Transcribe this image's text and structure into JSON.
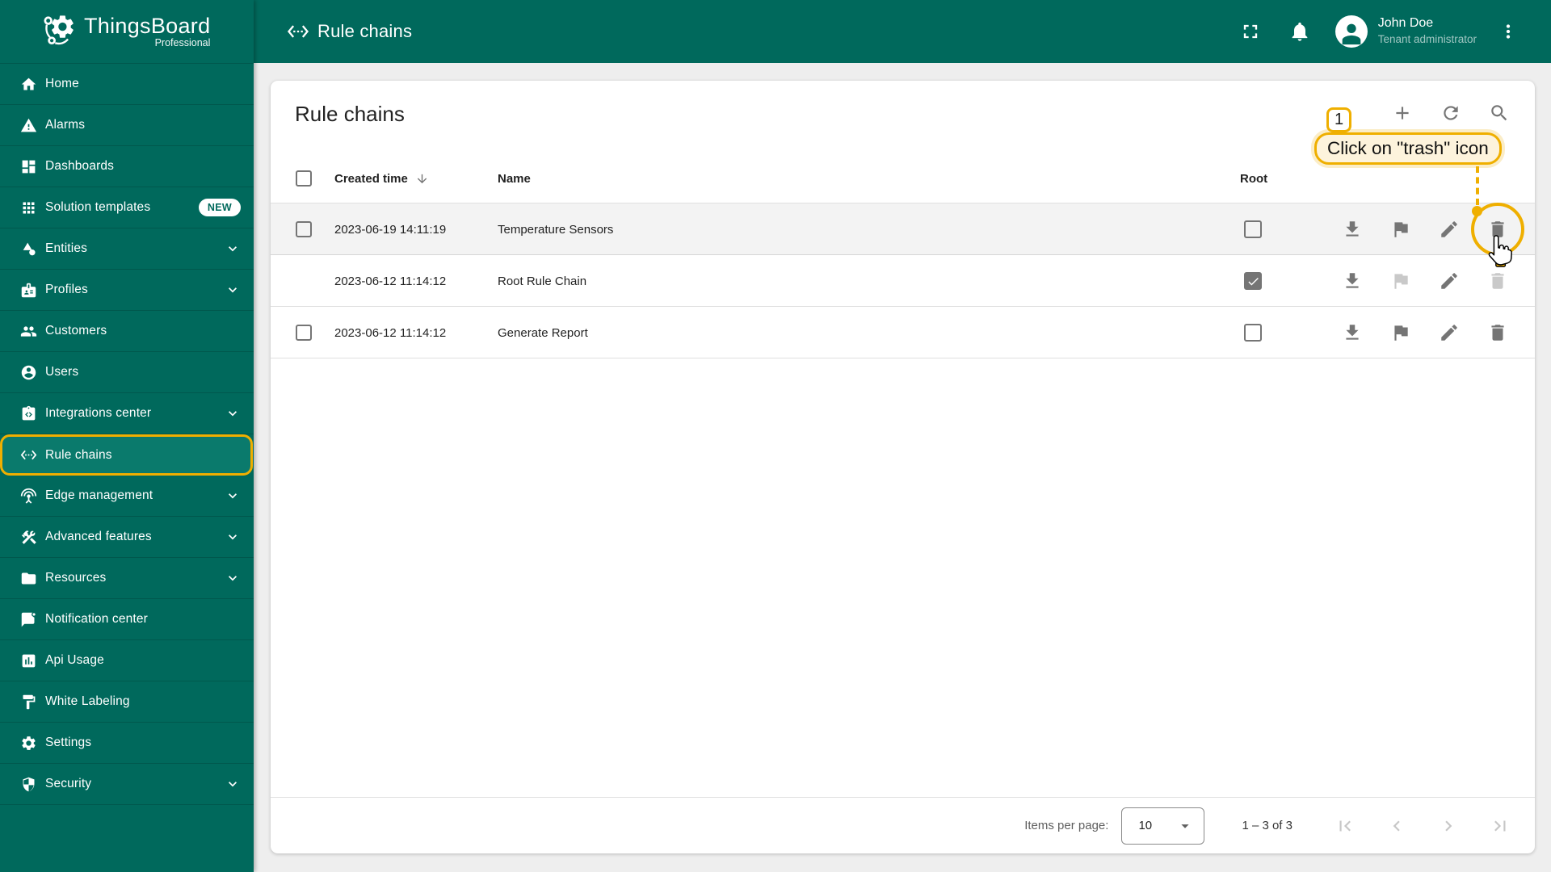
{
  "app": {
    "name": "ThingsBoard",
    "edition": "Professional"
  },
  "topbar": {
    "title": "Rule chains",
    "user_name": "John Doe",
    "user_role": "Tenant administrator"
  },
  "sidebar": {
    "items": [
      {
        "label": "Home"
      },
      {
        "label": "Alarms"
      },
      {
        "label": "Dashboards"
      },
      {
        "label": "Solution templates",
        "badge": "NEW"
      },
      {
        "label": "Entities",
        "expandable": true
      },
      {
        "label": "Profiles",
        "expandable": true
      },
      {
        "label": "Customers"
      },
      {
        "label": "Users"
      },
      {
        "label": "Integrations center",
        "expandable": true
      },
      {
        "label": "Rule chains",
        "selected": true
      },
      {
        "label": "Edge management",
        "expandable": true
      },
      {
        "label": "Advanced features",
        "expandable": true
      },
      {
        "label": "Resources",
        "expandable": true
      },
      {
        "label": "Notification center"
      },
      {
        "label": "Api Usage"
      },
      {
        "label": "White Labeling"
      },
      {
        "label": "Settings"
      },
      {
        "label": "Security",
        "expandable": true
      }
    ]
  },
  "page": {
    "title": "Rule chains",
    "columns": {
      "created_time": "Created time",
      "name": "Name",
      "root": "Root"
    },
    "rows": [
      {
        "created_time": "2023-06-19 14:11:19",
        "name": "Temperature Sensors",
        "root": false,
        "selectable": true,
        "hovered": true,
        "disabled_actions": []
      },
      {
        "created_time": "2023-06-12 11:14:12",
        "name": "Root Rule Chain",
        "root": true,
        "selectable": false,
        "hovered": false,
        "disabled_actions": [
          "flag",
          "delete"
        ]
      },
      {
        "created_time": "2023-06-12 11:14:12",
        "name": "Generate Report",
        "root": false,
        "selectable": true,
        "hovered": false,
        "disabled_actions": []
      }
    ],
    "pagination": {
      "items_per_page_label": "Items per page:",
      "items_per_page": "10",
      "range_label": "1 – 3 of 3"
    }
  },
  "annotation": {
    "step": "1",
    "text": "Click on \"trash\" icon",
    "target": "delete button of first table row",
    "accent_color": "#EFAF00"
  },
  "colors": {
    "primary_teal": "#00695C",
    "selected_item_bg": "#0A7A6C",
    "accent_gold": "#EFAF00",
    "tooltip_bg": "#FDF3DC",
    "content_bg": "#EEEEEE",
    "icon_gray": "#757575",
    "icon_disabled": "#C9C9C9"
  }
}
